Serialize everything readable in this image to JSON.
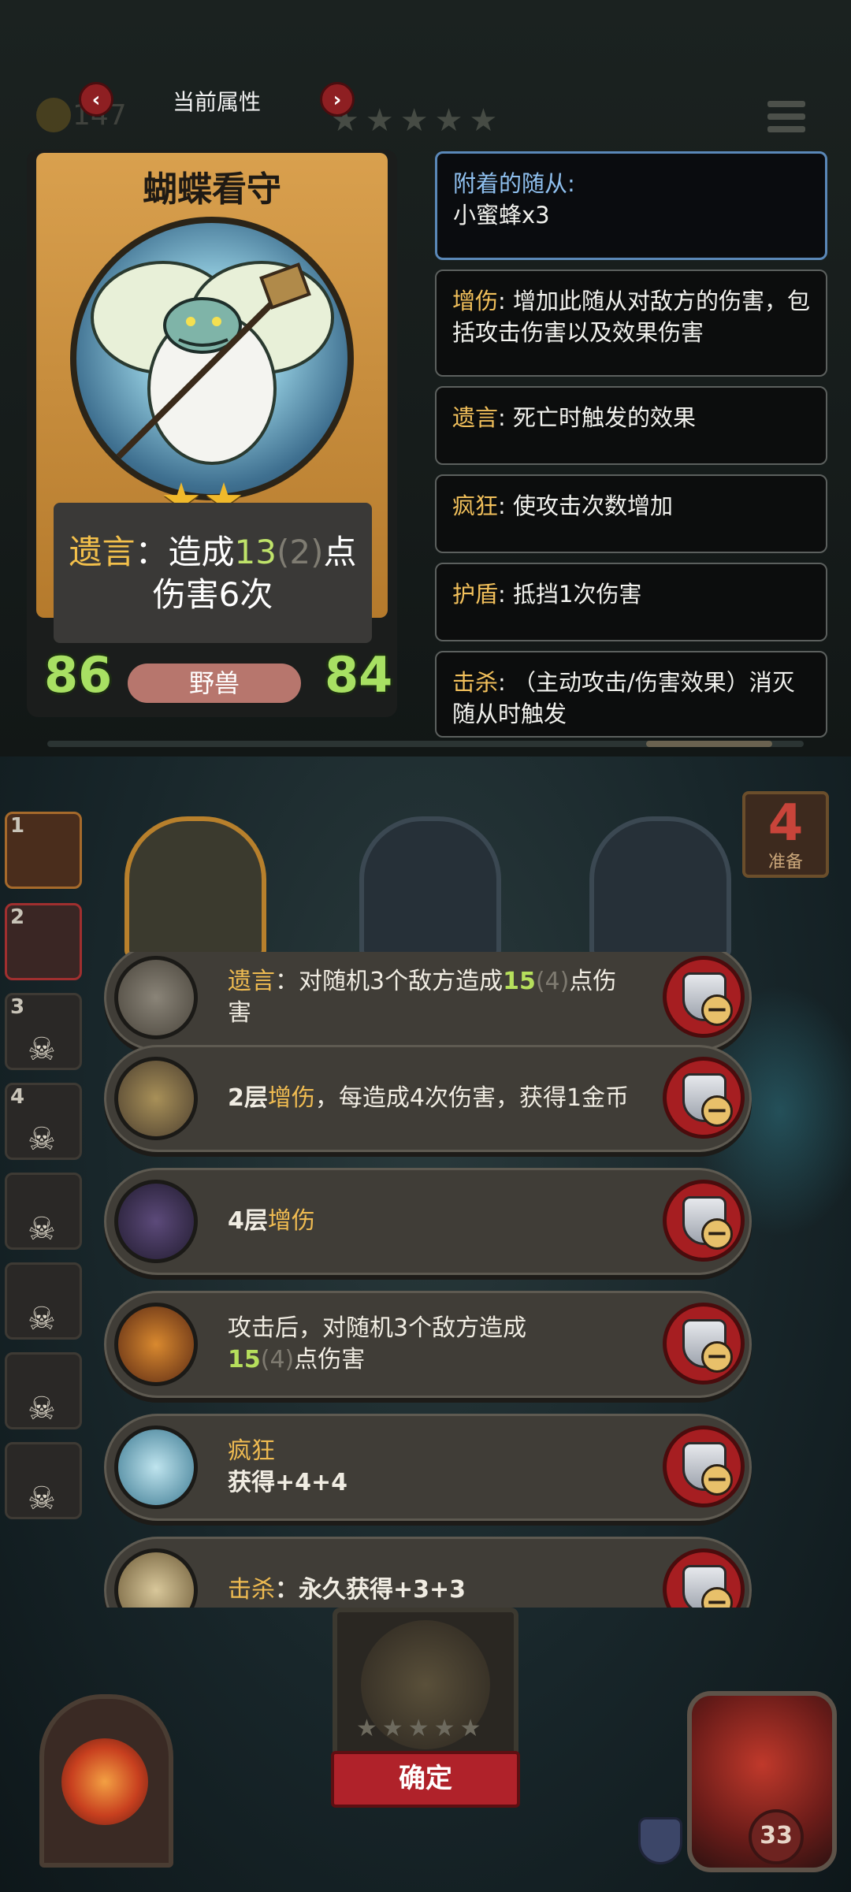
{
  "header": {
    "title": "当前属性",
    "prev_icon": "‹",
    "next_icon": "›",
    "gold": "147"
  },
  "card": {
    "name": "蝴蝶看守",
    "stars": "★★",
    "ability_keyword": "遗言",
    "ability_pre": "：造成",
    "ability_num": "13",
    "ability_dim": "(2)",
    "ability_post": "点",
    "ability_line2": "伤害6次",
    "attack": "86",
    "health": "84",
    "tribe": "野兽"
  },
  "info_panels": {
    "attached": {
      "title": "附着的随从:",
      "value": "小蜜蜂x3"
    },
    "damage_up": {
      "keyword": "增伤",
      "text": ": 增加此随从对敌方的伤害，包括攻击伤害以及效果伤害"
    },
    "deathrattle": {
      "keyword": "遗言",
      "text": ": 死亡时触发的效果"
    },
    "frenzy": {
      "keyword": "疯狂",
      "text": ": 使攻击次数增加"
    },
    "shield": {
      "keyword": "护盾",
      "text": ": 抵挡1次伤害"
    },
    "kill": {
      "keyword": "击杀",
      "text": ": （主动攻击/伤害效果）消灭随从时触发"
    }
  },
  "lineup": {
    "slot_numbers": [
      "1",
      "2",
      "3",
      "4"
    ],
    "skull": "☠",
    "ready_count": "4",
    "ready_label": "准备"
  },
  "effects": [
    {
      "kw": "遗言",
      "pre": "：对随机3个敌方造成",
      "num": "15",
      "dim": "(4)",
      "post": "点伤害"
    },
    {
      "pre": "2层",
      "kw": "增伤",
      "post": "，每造成4次伤害，获得1金币"
    },
    {
      "pre": "4层",
      "kw": "增伤"
    },
    {
      "line1": "攻击后，对随机3个敌方造成",
      "num": "15",
      "dim": "(4)",
      "post": "点伤害"
    },
    {
      "kw": "疯狂",
      "line2": "获得+4+4"
    },
    {
      "kw": "击杀",
      "post": "：永久获得+3+3"
    }
  ],
  "bottom": {
    "stars": "★★★★★",
    "confirm_label": "确定",
    "hero_health": "33"
  },
  "colors": {
    "keyword_gold": "#efbb51",
    "number_green": "#b6df5c",
    "stat_green": "#a8e063",
    "button_red": "#b0222a",
    "panel_highlight": "#5a88b8"
  }
}
